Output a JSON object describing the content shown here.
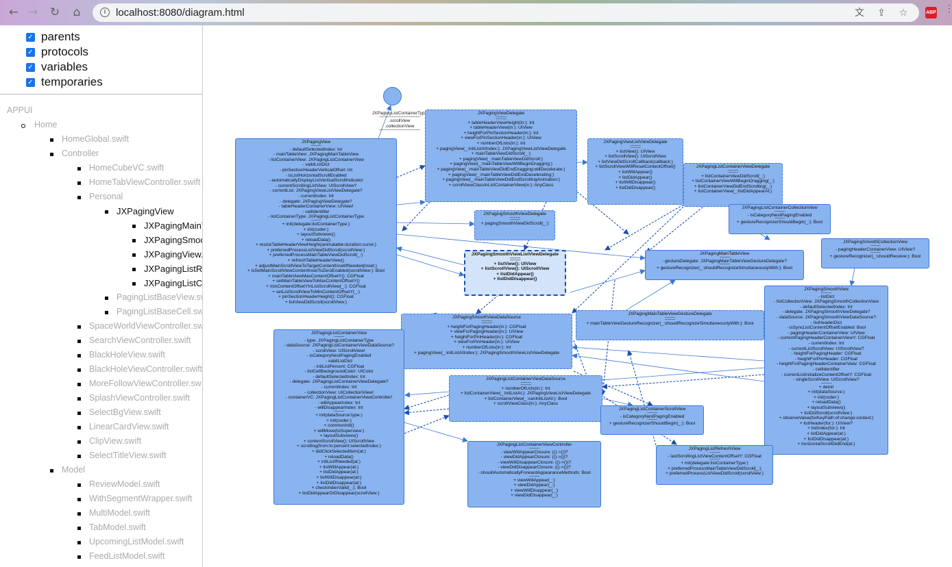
{
  "browser": {
    "url": "localhost:8080/diagram.html",
    "icons": [
      "back-icon",
      "forward-icon",
      "reload-icon",
      "home-icon",
      "info-icon",
      "translate-icon",
      "share-icon",
      "bookmark-star-icon",
      "adblock-icon",
      "menu-icon"
    ],
    "abp_label": "ABP"
  },
  "filters": [
    {
      "label": "parents",
      "checked": true
    },
    {
      "label": "protocols",
      "checked": true
    },
    {
      "label": "variables",
      "checked": true
    },
    {
      "label": "temporaries",
      "checked": true
    }
  ],
  "tree": {
    "root": "APPUI",
    "items": [
      {
        "label": "Home",
        "level": 1,
        "bullet": "circle",
        "dark": false
      },
      {
        "label": "HomeGlobal.swift",
        "level": 2,
        "dark": false
      },
      {
        "label": "Controller",
        "level": 2,
        "dark": false
      },
      {
        "label": "HomeCubeVC.swift",
        "level": 3,
        "dark": false
      },
      {
        "label": "HomeTabViewController.swift",
        "level": 3,
        "dark": false
      },
      {
        "label": "Personal",
        "level": 3,
        "dark": false
      },
      {
        "label": "JXPagingView",
        "level": 4,
        "dark": true
      },
      {
        "label": "JXPagingMainT",
        "level": 5,
        "dark": true
      },
      {
        "label": "JXPagingSmoot",
        "level": 5,
        "dark": true
      },
      {
        "label": "JXPagingView.s",
        "level": 5,
        "dark": true
      },
      {
        "label": "JXPagingListRe",
        "level": 5,
        "dark": true
      },
      {
        "label": "JXPagingListCo",
        "level": 5,
        "dark": true
      },
      {
        "label": "PagingListBaseView.sw",
        "level": 4,
        "dark": false
      },
      {
        "label": "PagingListBaseCell.sw",
        "level": 4,
        "dark": false
      },
      {
        "label": "SpaceWorldViewController.sw",
        "level": 3,
        "dark": false
      },
      {
        "label": "SearchViewController.swift",
        "level": 3,
        "dark": false
      },
      {
        "label": "BlackHoleView.swift",
        "level": 3,
        "dark": false
      },
      {
        "label": "BlackHoleViewController.swift",
        "level": 3,
        "dark": false
      },
      {
        "label": "MoreFollowViewController.sw",
        "level": 3,
        "dark": false
      },
      {
        "label": "SplashViewController.swift",
        "level": 3,
        "dark": false
      },
      {
        "label": "SelectBgView.swift",
        "level": 3,
        "dark": false
      },
      {
        "label": "LinearCardView.swift",
        "level": 3,
        "dark": false
      },
      {
        "label": "ClipView.swift",
        "level": 3,
        "dark": false
      },
      {
        "label": "SelectTitleView.swift",
        "level": 3,
        "dark": false
      },
      {
        "label": "Model",
        "level": 2,
        "dark": false
      },
      {
        "label": "ReviewModel.swift",
        "level": 3,
        "dark": false
      },
      {
        "label": "WithSegmentWrapper.swift",
        "level": 3,
        "dark": false
      },
      {
        "label": "MultiModel.swift",
        "level": 3,
        "dark": false
      },
      {
        "label": "TabModel.swift",
        "level": 3,
        "dark": false
      },
      {
        "label": "UpcomingListModel.swift",
        "level": 3,
        "dark": false
      },
      {
        "label": "FeedListModel.swift",
        "level": 3,
        "dark": false
      }
    ]
  },
  "edge_label": {
    "title": "JXPagingListContainerType",
    "lines": [
      "=================",
      ".scrollView",
      ".collectionView",
      "================="
    ]
  },
  "nodes": [
    {
      "id": "JXPagingView",
      "style": "solid",
      "lines": [
        "JXPagingView",
        "=====",
        "- defaultSelectedIndex: Int",
        "- mainTableView: JXPagingMainTableView",
        "- listContainerView: JXPagingListContainerView",
        "- validListDict",
        "- pinSectionHeaderVerticalOffset: Int",
        "- isListHorizontalScrollEnabled",
        "- automaticallyDisplayListVerticalScrollIndicator",
        "- currentScrollingListView: UIScrollView?",
        "- currentList: JXPagingViewListViewDelegate?",
        "- currentIndex: Int",
        "- delegate: JXPagingViewDelegate?",
        "- tableHeaderContainerView: UIView!",
        "- cellIdentifier",
        "- listContainerType: JXPagingListContainerType",
        "=====",
        "+ init(delegate:listContainerType:)",
        "+ init(coder:)",
        "+ layoutSubviews()",
        "+ reloadData()",
        "+ resizeTableHeaderViewHeight(animatable:duration:curve:)",
        "+ preferredProcessListViewDidScroll(scrollView:)",
        "+ preferredProcessMainTableViewDidScroll(_:)",
        "+ refreshTableHeaderView()",
        "+ adjustMainScrollViewToTargetContentInsetIfNeeded(inset:)",
        "+ isSetMainScrollViewContentInsetToZeroEnabled(scrollView:): Bool",
        "+ mainTableViewMaxContentOffsetY(): CGFloat",
        "+ setMainTableViewToMaxContentOffsetY()",
        "+ minContentOffsetYInListScrollView(_:): CGFloat",
        "+ setListScrollViewToMinContentOffsetY(_:)",
        "+ pinSectionHeaderHeight(): CGFloat",
        "+ listViewDidScroll(scrollView:)"
      ]
    },
    {
      "id": "JXPagingViewDelegate",
      "style": "dashed",
      "lines": [
        "JXPagingViewDelegate",
        "=====",
        "=====",
        "+ tableHeaderViewHeight(in:): Int",
        "+ tableHeaderView(in:): UIView",
        "+ heightForPinSectionHeader(in:): Int",
        "+ viewForPinSectionHeader(in:): UIView",
        "+ numberOfLists(in:): Int",
        "+ pagingView(_:initListAtIndex:): JXPagingViewListViewDelegate",
        "+ mainTableViewDidScroll(_:)",
        "+ pagingView(_:mainTableViewDidScroll:)",
        "+ pagingView(_:mainTableViewWillBeginDragging:)",
        "+ pagingView(_:mainTableViewDidEndDragging:willDecelerate:)",
        "+ pagingView(_:mainTableViewDidEndDecelerating:)",
        "+ pagingView(_:mainTableViewDidEndScrollingAnimation:)",
        "+ scrollViewClassInListContainerView(in:): AnyClass"
      ]
    },
    {
      "id": "JXPagingViewListViewDelegate",
      "style": "dashed",
      "lines": [
        "JXPagingViewListViewDelegate",
        "=====",
        "=====",
        "+ listView(): UIView",
        "+ listScrollView(): UIScrollView",
        "+ listViewDidScrollCallback(callback:)",
        "+ listScrollViewWillResetContentOffset()",
        "+ listWillAppear()",
        "+ listDidAppear()",
        "+ listWillDisappear()",
        "+ listDidDisappear()"
      ]
    },
    {
      "id": "JXPagingListContainerViewDelegate",
      "style": "dashed",
      "lines": [
        "JXPagingListContainerViewDelegate",
        "=====",
        "=====",
        "+ listContainerViewDidScroll(_:)",
        "+ listContainerViewWillBeginDragging(_:)",
        "+ listContainerViewDidEndScrolling(_:)",
        "+ listContainerView(_:listDidAppearAt:)"
      ]
    },
    {
      "id": "JXPagingListContainerCollectionView",
      "style": "solid",
      "lines": [
        "JXPagingListContainerCollectionView",
        "=====",
        "- isCategoryNestPagingEnabled",
        "=====",
        "+ gestureRecognizerShouldBegin(_:): Bool"
      ]
    },
    {
      "id": "JXPagingSmoothViewDelegate",
      "style": "dashed",
      "lines": [
        "JXPagingSmoothViewDelegate",
        "=====",
        "=====",
        "+ pagingSmoothViewDidScroll(_:)"
      ]
    },
    {
      "id": "JXPagingSmoothViewListViewDelegate",
      "style": "highlight",
      "lines": [
        "JXPagingSmoothViewListViewDelegate",
        "=====",
        "=====",
        "+ listView(): UIView",
        "+ listScrollView(): UIScrollView",
        "+ listDidAppear()",
        "+ listDidDisappear()"
      ]
    },
    {
      "id": "JXPagingMainTableView",
      "style": "solid",
      "lines": [
        "JXPagingMainTableView",
        "=====",
        "- gestureDelegate: JXPagingMainTableViewGestureDelegate?",
        "=====",
        "+ gestureRecognizer(_:shouldRecognizeSimultaneouslyWith:): Bool"
      ]
    },
    {
      "id": "JXPagingSmoothCollectionView",
      "style": "solid",
      "lines": [
        "JXPagingSmoothCollectionView",
        "=====",
        "- pagingHeaderContainerView: UIView?",
        "=====",
        "+ gestureRecognizer(_:shouldReceive:): Bool"
      ]
    },
    {
      "id": "JXPagingSmoothView",
      "style": "solid",
      "lines": [
        "JXPagingSmoothView",
        "=====",
        "- listDict",
        "- listCollectionView: JXPagingSmoothCollectionView",
        "- defaultSelectedIndex: Int",
        "- delegate: JXPagingSmoothViewDelegate?",
        "- dataSource: JXPagingSmoothViewDataSource?",
        "- listHeaderDict",
        "- isSyncListContentOffsetEnabled: Bool",
        "- pagingHeaderContainerView: UIView",
        "- currentPagingHeaderContainerViewY: CGFloat",
        "- currentIndex: Int",
        "- currentListScrollView: UIScrollView?",
        "- heightForPagingHeader: CGFloat",
        "- heightForPinHeader: CGFloat",
        "- heightForPagingHeaderContainerView: CGFloat",
        "- cellIdentifier",
        "- currentListInitializeContentOffsetY: CGFloat",
        "- singleScrollView: UIScrollView?",
        "=====",
        "+ deinit",
        "+ init(dataSource:)",
        "+ init(coder:)",
        "+ reloadData()",
        "+ layoutSubviews()",
        "+ listDidScroll(scrollView:)",
        "+ observeValue(forKeyPath:of:change:context:)",
        "+ listHeader(for:): UIView?",
        "+ listIndex(for:): Int",
        "+ listDidAppear(at:)",
        "+ listDidDisappear(at:)",
        "+ horizontalScrollDidEnd(at:)"
      ]
    },
    {
      "id": "JXPagingSmoothViewDataSource",
      "style": "dashed",
      "lines": [
        "JXPagingSmoothViewDataSource",
        "=====",
        "=====",
        "+ heightForPagingHeader(in:): CGFloat",
        "+ viewForPagingHeader(in:): UIView",
        "+ heightForPinHeader(in:): CGFloat",
        "+ viewForPinHeader(in:): UIView",
        "+ numberOfLists(in:): Int",
        "+ pagingView(_:initListAtIndex:): JXPagingSmoothViewListViewDelegate"
      ]
    },
    {
      "id": "JXPagingMainTableViewGestureDelegate",
      "style": "dashed",
      "lines": [
        "JXPagingMainTableViewGestureDelegate",
        "=====",
        "=====",
        "+ mainTableViewGestureRecognizer(_:shouldRecognizeSimultaneouslyWith:): Bool"
      ]
    },
    {
      "id": "JXPagingListContainerView",
      "style": "solid",
      "lines": [
        "JXPagingListContainerView",
        "=====",
        "- type: JXPagingListContainerType",
        "- dataSource: JXPagingListContainerViewDataSource?",
        "- scrollView: UIScrollView!",
        "- isCategoryNestPagingEnabled",
        "- validListDict",
        "- initListPercent: CGFloat",
        "- listCellBackgroundColor: UIColor",
        "- defaultSelectedIndex: Int",
        "- delegate: JXPagingListContainerViewDelegate?",
        "- currentIndex: Int",
        "- collectionView: UICollectionView!",
        "- containerVC: JXPagingListContainerViewController!",
        "- willAppearIndex: Int",
        "- willDisappearIndex: Int",
        "=====",
        "+ init(dataSource:type:)",
        "+ init(coder:)",
        "+ commonInit()",
        "+ willMove(toSuperview:)",
        "+ layoutSubviews()",
        "+ contentScrollView(): UIScrollView",
        "+ scrolling(from:to:percent:selectedIndex:)",
        "+ didClickSelectedItem(at:)",
        "+ reloadData()",
        "+ initListIfNeeded(at:)",
        "+ listWillAppear(at:)",
        "+ listDidAppear(at:)",
        "+ listWillDisappear(at:)",
        "+ listDidDisappear(at:)",
        "+ checkIndexValid(_:): Bool",
        "+ listDidAppearOrDisappear(scrollView:)"
      ]
    },
    {
      "id": "JXPagingListContainerViewDataSource",
      "style": "dashed",
      "lines": [
        "JXPagingListContainerViewDataSource",
        "=====",
        "=====",
        "+ numberOfLists(in:): Int",
        "+ listContainerView(_:initListAt:): JXPagingViewListViewDelegate",
        "+ listContainerView(_:canInitListAt:): Bool",
        "+ scrollViewClass(in:): AnyClass"
      ]
    },
    {
      "id": "JXPagingListContainerScrollView",
      "style": "solid",
      "lines": [
        "JXPagingListContainerScrollView",
        "=====",
        "- isCategoryNestPagingEnabled",
        "=====",
        "+ gestureRecognizerShouldBegin(_:): Bool"
      ]
    },
    {
      "id": "JXPagingListContainerViewController",
      "style": "solid",
      "lines": [
        "JXPagingListContainerViewController",
        "=====",
        "- viewWillAppearClosure: (()->())?",
        "- viewDidAppearClosure: (()->())?",
        "- viewWillDisappearClosure: (()->())?",
        "- viewDidDisappearClosure: (()->())?",
        "- shouldAutomaticallyForwardAppearanceMethods: Bool",
        "=====",
        "+ viewWillAppear(_:)",
        "+ viewDidAppear(_:)",
        "+ viewWillDisappear(_:)",
        "+ viewDidDisappear(_:)"
      ]
    },
    {
      "id": "JXPagingListRefreshView",
      "style": "solid",
      "lines": [
        "JXPagingListRefreshView",
        "=====",
        "- lastScrollingListViewContentOffsetY: CGFloat",
        "=====",
        "+ init(delegate:listContainerType:)",
        "+ preferredProcessMainTableViewDidScroll(_:)",
        "+ preferredProcessListViewDidScroll(scrollView:)"
      ]
    }
  ]
}
